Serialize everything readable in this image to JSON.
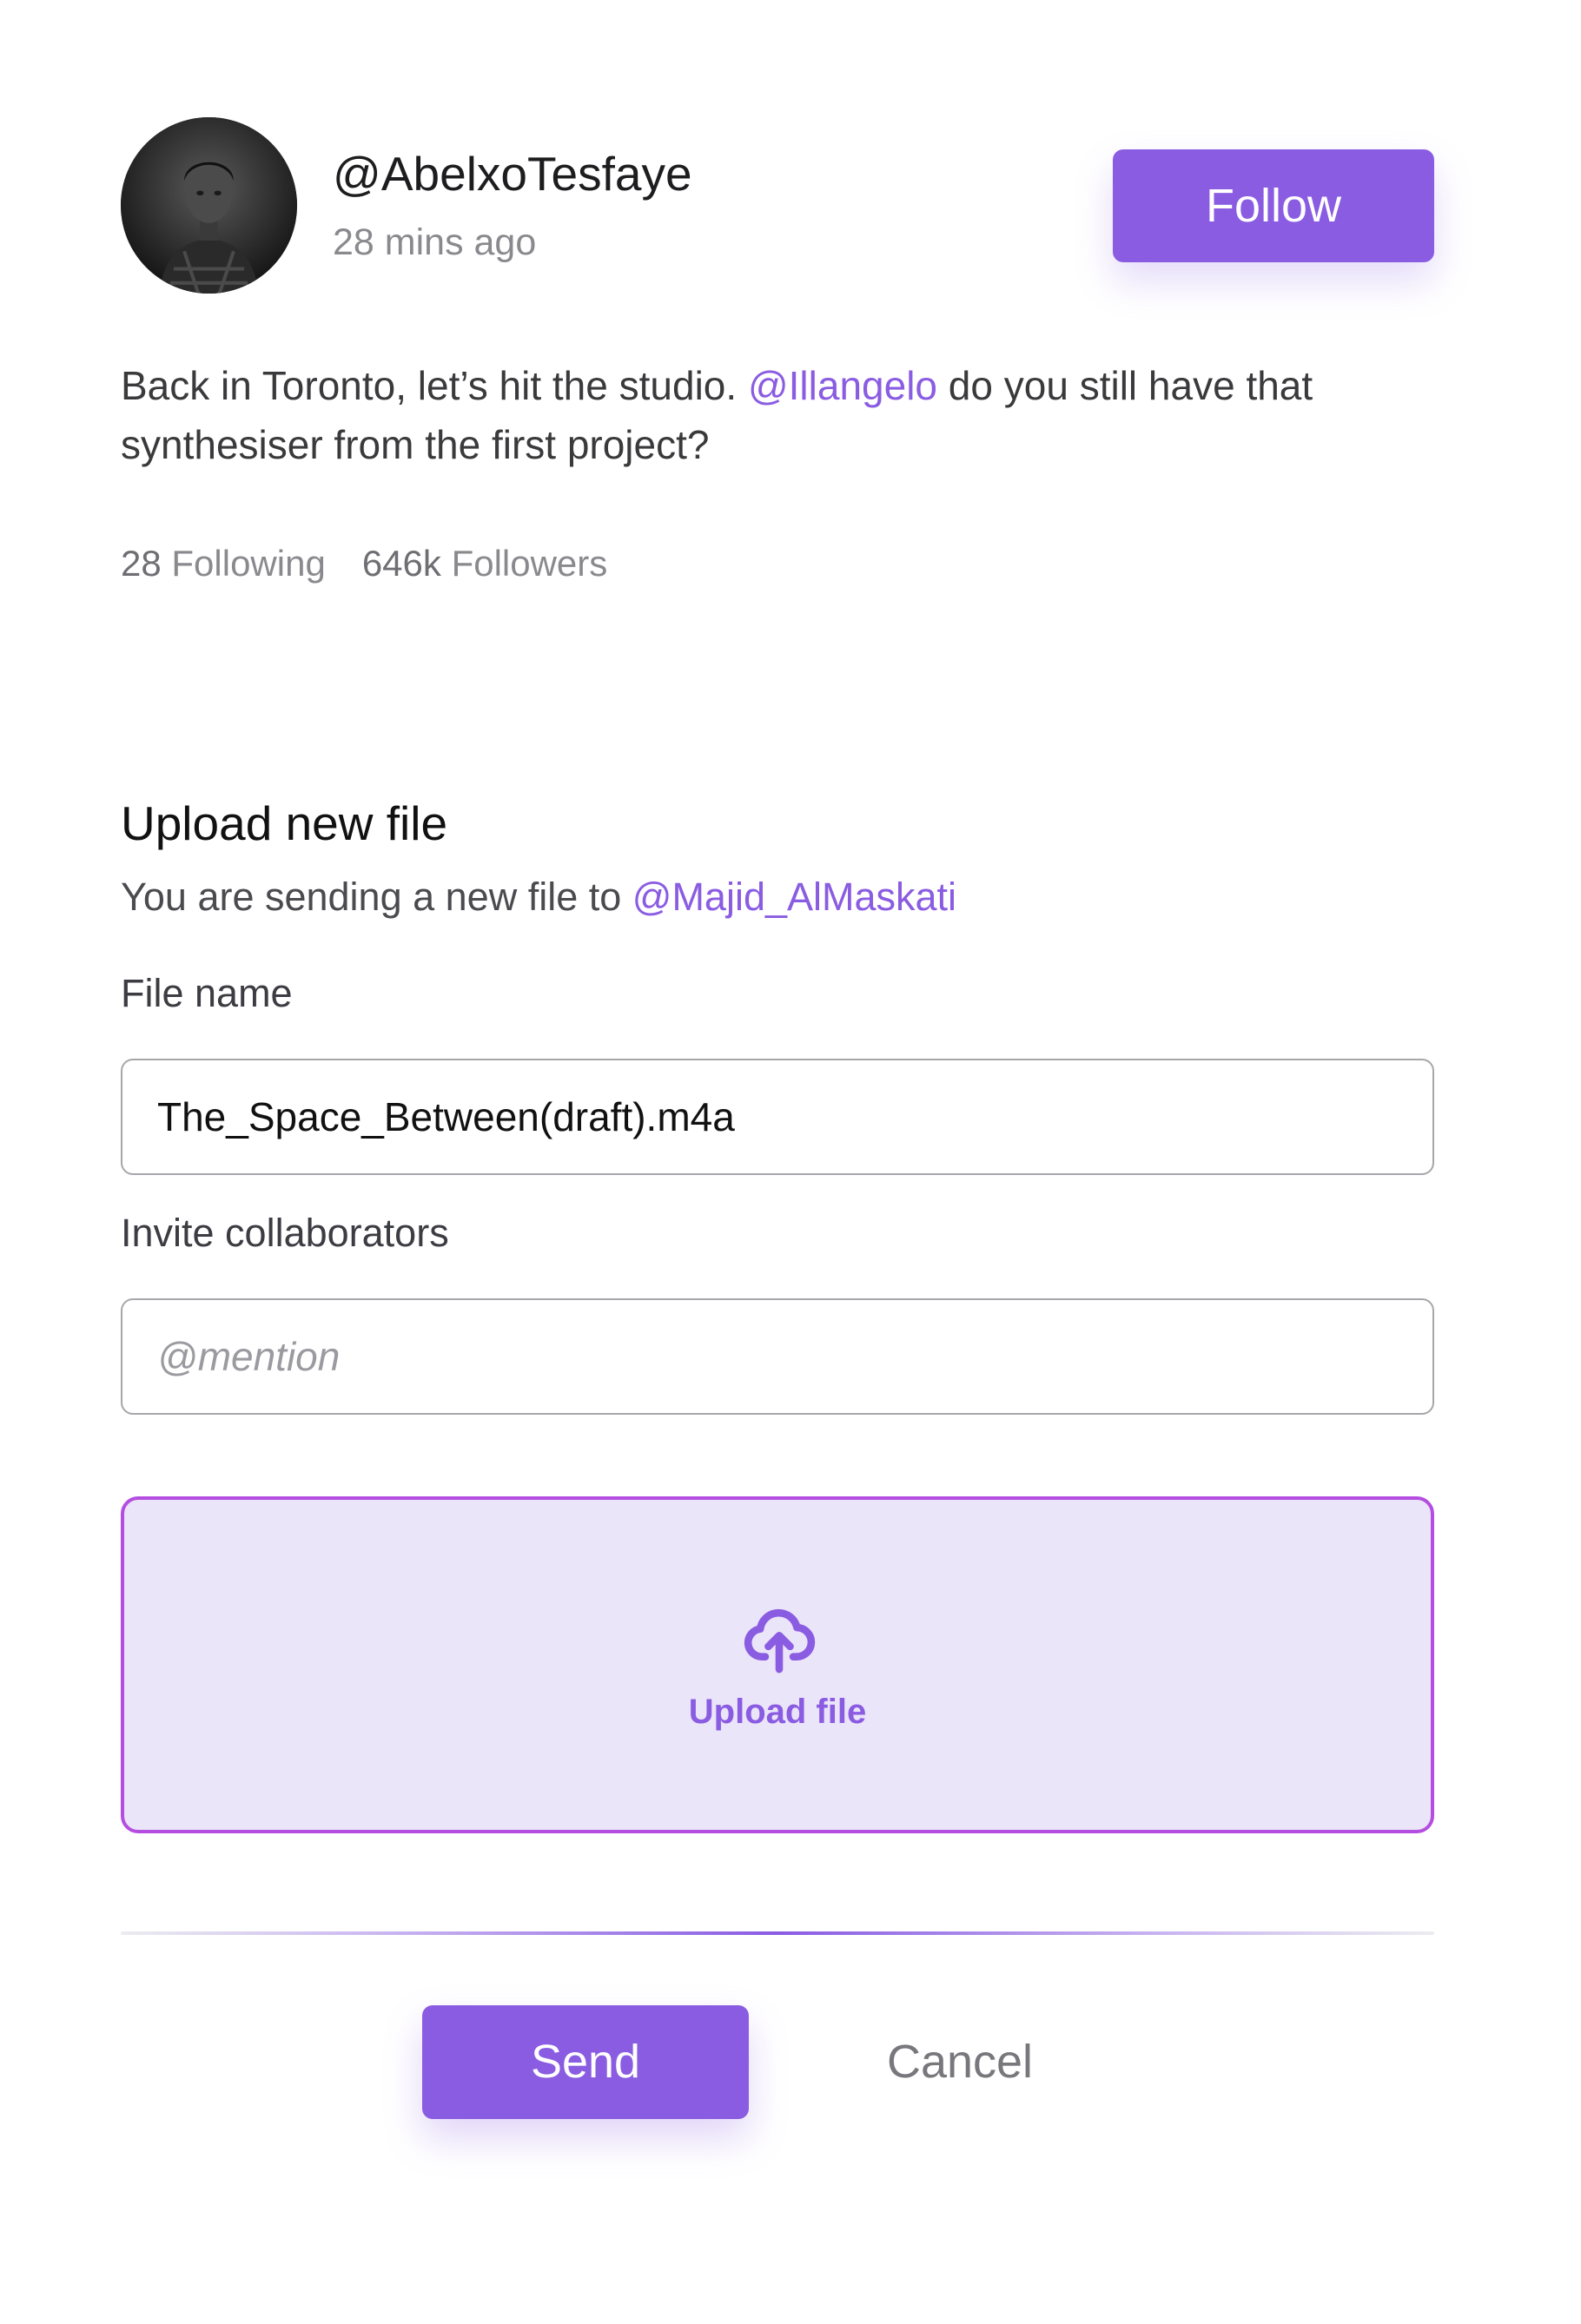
{
  "post": {
    "username": "@AbelxoTesfaye",
    "timestamp": "28 mins ago",
    "follow_label": "Follow",
    "body_before": "Back in Toronto, let’s hit the studio. ",
    "body_mention": "@Illangelo",
    "body_after": " do you still have that synthesiser from the first project?",
    "following_count": "28",
    "following_label": "Following",
    "followers_count": "646k",
    "followers_label": "Followers"
  },
  "upload": {
    "title": "Upload new file",
    "subtitle_prefix": "You are sending a new file to ",
    "recipient": "@Majid_AlMaskati",
    "file_name_label": "File name",
    "file_name_value": "The_Space_Between(draft).m4a",
    "collaborators_label": "Invite collaborators",
    "collaborators_placeholder": "@mention",
    "dropzone_label": "Upload file",
    "dropzone_icon": "cloud-upload-icon"
  },
  "actions": {
    "send_label": "Send",
    "cancel_label": "Cancel"
  },
  "colors": {
    "accent": "#8a5ce2",
    "dropzone_border": "#b44ee0",
    "dropzone_fill": "#ebe5f9"
  }
}
